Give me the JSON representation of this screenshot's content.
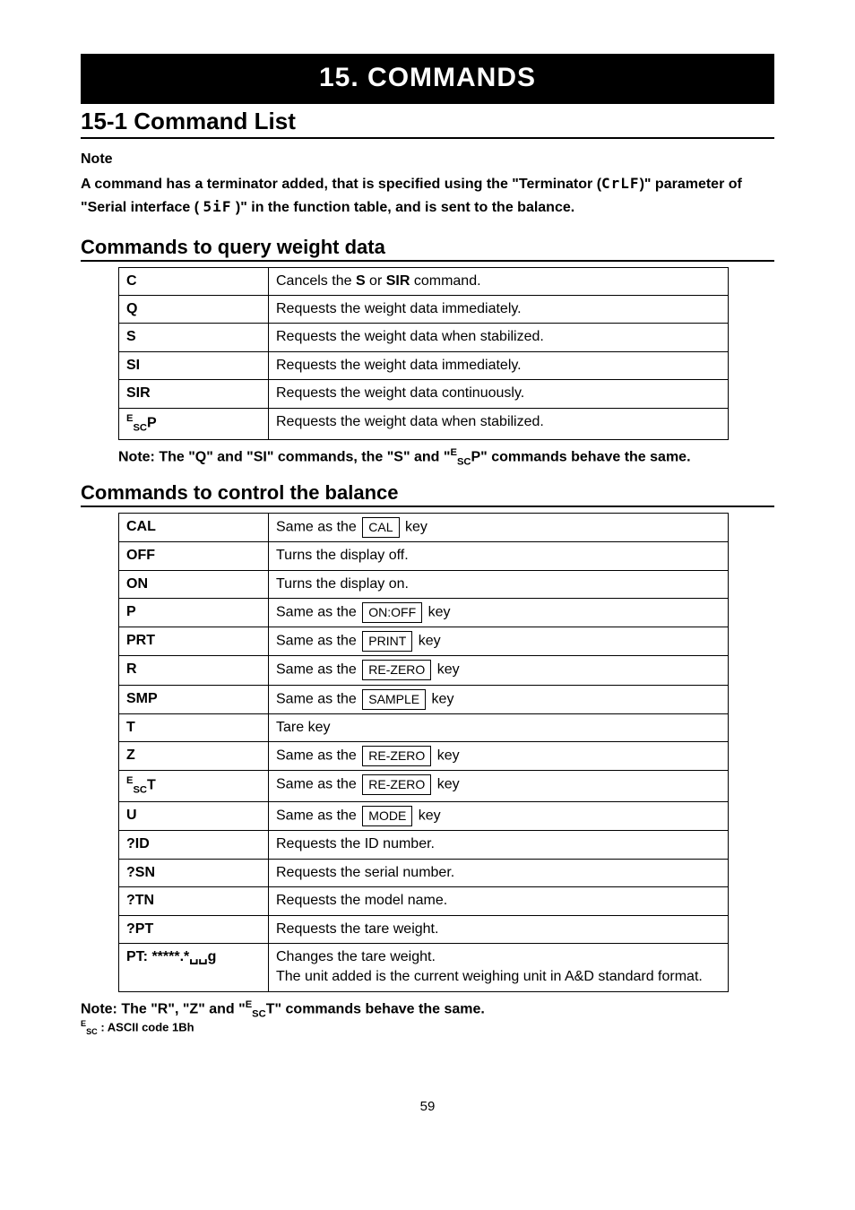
{
  "chapter": {
    "number": "15.",
    "title": "COMMANDS"
  },
  "section": {
    "number": "15-1",
    "title": "Command List"
  },
  "note_heading": "Note",
  "note_paragraph_a": "A command has a terminator added, that is specified using the \"Terminator (",
  "note_terminator_code": "CrLF",
  "note_paragraph_b": ")\" parameter of \"Serial interface (",
  "note_sif_code": "5iF",
  "note_paragraph_c": ")\" in the function table, and is sent to the balance.",
  "query_section_title": "Commands to query weight data",
  "query_commands": [
    {
      "cmd_html": "C",
      "desc_html": "Cancels the <b>S</b> or <b>SIR</b> command."
    },
    {
      "cmd_html": "Q",
      "desc_html": "Requests the weight data immediately."
    },
    {
      "cmd_html": "S",
      "desc_html": "Requests the weight data when stabilized."
    },
    {
      "cmd_html": "SI",
      "desc_html": "Requests the weight data immediately."
    },
    {
      "cmd_html": "SIR",
      "desc_html": "Requests the weight data continuously."
    },
    {
      "cmd_html": "<span class=\"sup\">E</span><span class=\"sub\">SC</span>P",
      "desc_html": "Requests the weight data when stabilized."
    }
  ],
  "query_note": "Note: The \"Q\" and \"SI\" commands, the \"S\" and \"<span class=\"sup\">E</span><span class=\"sub\">SC</span>P\" commands behave the same.",
  "control_section_title": "Commands to control the balance",
  "control_commands": [
    {
      "cmd_html": "CAL",
      "desc_html": "Same as the  <span class=\"keybox\">CAL</span>  key"
    },
    {
      "cmd_html": "OFF",
      "desc_html": "Turns the display off."
    },
    {
      "cmd_html": "ON",
      "desc_html": "Turns the display on."
    },
    {
      "cmd_html": "P",
      "desc_html": "Same as the  <span class=\"keybox\">ON:OFF</span>  key"
    },
    {
      "cmd_html": "PRT",
      "desc_html": "Same as the  <span class=\"keybox\">PRINT</span>  key"
    },
    {
      "cmd_html": "R",
      "desc_html": "Same as the  <span class=\"keybox\">RE-ZERO</span>  key"
    },
    {
      "cmd_html": "SMP",
      "desc_html": "Same as the  <span class=\"keybox\">SAMPLE</span>  key"
    },
    {
      "cmd_html": "T",
      "desc_html": "Tare key"
    },
    {
      "cmd_html": "Z",
      "desc_html": "Same as the  <span class=\"keybox\">RE-ZERO</span>  key"
    },
    {
      "cmd_html": "<span class=\"sup\">E</span><span class=\"sub\">SC</span>T",
      "desc_html": "Same as the  <span class=\"keybox\">RE-ZERO</span>  key"
    },
    {
      "cmd_html": "U",
      "desc_html": "Same as the  <span class=\"keybox\">MODE</span>  key"
    },
    {
      "cmd_html": "?ID",
      "desc_html": "Requests the ID number."
    },
    {
      "cmd_html": "?SN",
      "desc_html": "Requests the serial number."
    },
    {
      "cmd_html": "?TN",
      "desc_html": "Requests the model name."
    },
    {
      "cmd_html": "?PT",
      "desc_html": "Requests the tare weight."
    },
    {
      "cmd_html": "PT: *****.*␣␣g",
      "desc_html": "Changes the tare weight.<br>The unit added is the current weighing unit in A&amp;D standard format."
    }
  ],
  "control_note_line1": "Note: The \"R\", \"Z\" and \"<span class=\"sup\">E</span><span class=\"sub\">SC</span>T\" commands behave the same.",
  "control_note_line2": "<span class=\"sup\">E</span><span class=\"sub\">SC</span> : ASCII code 1Bh",
  "page_number": "59"
}
